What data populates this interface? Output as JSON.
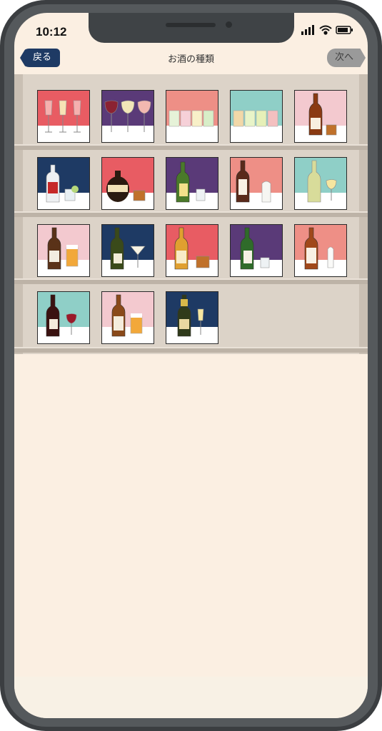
{
  "status_bar": {
    "time": "10:12"
  },
  "nav": {
    "back_label": "戻る",
    "title": "お酒の種類",
    "next_label": "次へ"
  },
  "colors": {
    "red": "#e85c63",
    "purple": "#5a3a78",
    "pink": "#f3c9cf",
    "mint": "#8fcfc7",
    "salmon": "#ee8f86",
    "navy": "#1e3a64"
  },
  "tiles": [
    {
      "name": "rose-wine",
      "bg": "red"
    },
    {
      "name": "wine-glasses",
      "bg": "purple"
    },
    {
      "name": "chuhai",
      "bg": "salmon"
    },
    {
      "name": "highball",
      "bg": "mint"
    },
    {
      "name": "brandy",
      "bg": "pink"
    },
    {
      "name": "gin",
      "bg": "navy"
    },
    {
      "name": "whisky",
      "bg": "red"
    },
    {
      "name": "shochu-green",
      "bg": "purple"
    },
    {
      "name": "sake",
      "bg": "salmon"
    },
    {
      "name": "white-wine",
      "bg": "mint"
    },
    {
      "name": "beer-bottle",
      "bg": "pink"
    },
    {
      "name": "martini",
      "bg": "navy"
    },
    {
      "name": "whisky-amber",
      "bg": "red"
    },
    {
      "name": "green-sake",
      "bg": "purple"
    },
    {
      "name": "umeshu",
      "bg": "salmon"
    },
    {
      "name": "red-wine",
      "bg": "mint"
    },
    {
      "name": "craft-beer",
      "bg": "pink"
    },
    {
      "name": "champagne",
      "bg": "navy"
    }
  ]
}
